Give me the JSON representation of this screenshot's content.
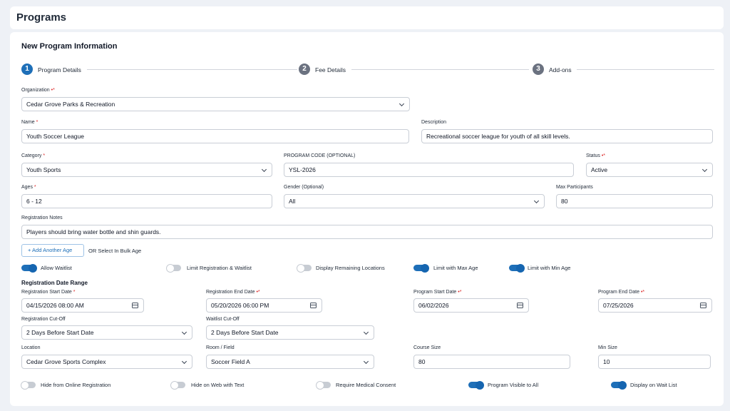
{
  "page": {
    "title": "Programs"
  },
  "card": {
    "title": "New Program Information"
  },
  "steps": [
    {
      "num": "1",
      "label": "Program Details"
    },
    {
      "num": "2",
      "label": "Fee Details"
    },
    {
      "num": "3",
      "label": "Add-ons"
    }
  ],
  "required_mark": "*",
  "required_dot_mark": "•*",
  "fields": {
    "organization": {
      "label": "Organization",
      "value": "Cedar Grove Parks & Recreation"
    },
    "name": {
      "label": "Name",
      "value": "Youth Soccer League"
    },
    "description": {
      "label": "Description",
      "value": "Recreational soccer league for youth of all skill levels."
    },
    "category": {
      "label": "Category",
      "value": "Youth Sports"
    },
    "program_code": {
      "label": "PROGRAM CODE (OPTIONAL)",
      "value": "YSL-2026"
    },
    "status": {
      "label": "Status",
      "value": "Active"
    },
    "ages": {
      "label": "Ages",
      "value": "6 - 12"
    },
    "gender": {
      "label": "Gender (Optional)",
      "value": "All"
    },
    "max_participants": {
      "label": "Max Participants",
      "value": "80"
    },
    "registration_notes": {
      "label": "Registration Notes",
      "value": "Players should bring water bottle and shin guards."
    },
    "reg_start": {
      "label": "Registration Start Date",
      "value": "04/15/2026 08:00 AM"
    },
    "reg_end": {
      "label": "Registration End Date",
      "value": "05/20/2026 06:00 PM"
    },
    "prog_start": {
      "label": "Program Start Date",
      "value": "06/02/2026"
    },
    "prog_end": {
      "label": "Program End Date",
      "value": "07/25/2026"
    },
    "reg_cutoff": {
      "label": "Registration Cut-Off",
      "value": "2 Days Before Start Date"
    },
    "waitlist_cutoff": {
      "label": "Waitlist Cut-Off",
      "value": "2 Days Before Start Date"
    },
    "location": {
      "label": "Location",
      "value": "Cedar Grove Sports Complex"
    },
    "room": {
      "label": "Room / Field",
      "value": "Soccer Field A"
    },
    "course_size": {
      "label": "Course Size",
      "value": "80"
    },
    "min_size": {
      "label": "Min Size",
      "value": "10"
    }
  },
  "add_age": {
    "icon": "plus-icon",
    "label": "+ Add Another Age",
    "bulk_text": "OR Select In Bulk Age"
  },
  "toggles_row1": [
    {
      "label": "Allow Waitlist",
      "on": true
    },
    {
      "label": "Limit Registration & Waitlist",
      "on": false
    },
    {
      "label": "Display Remaining Locations",
      "on": false
    },
    {
      "label": "Limit with Max Age",
      "on": true
    },
    {
      "label": "Limit with Min Age",
      "on": true
    }
  ],
  "date_section": {
    "title": "Registration Date Range"
  },
  "toggles_row2": [
    {
      "label": "Hide from Online Registration",
      "on": false
    },
    {
      "label": "Hide on Web with Text",
      "on": false
    },
    {
      "label": "Require Medical Consent",
      "on": false
    },
    {
      "label": "Program Visible to All",
      "on": true
    },
    {
      "label": "Display on Wait List",
      "on": true
    }
  ],
  "colors": {
    "accent": "#1e6fb8",
    "required": "#dc2626",
    "step_inactive": "#6b7280"
  }
}
